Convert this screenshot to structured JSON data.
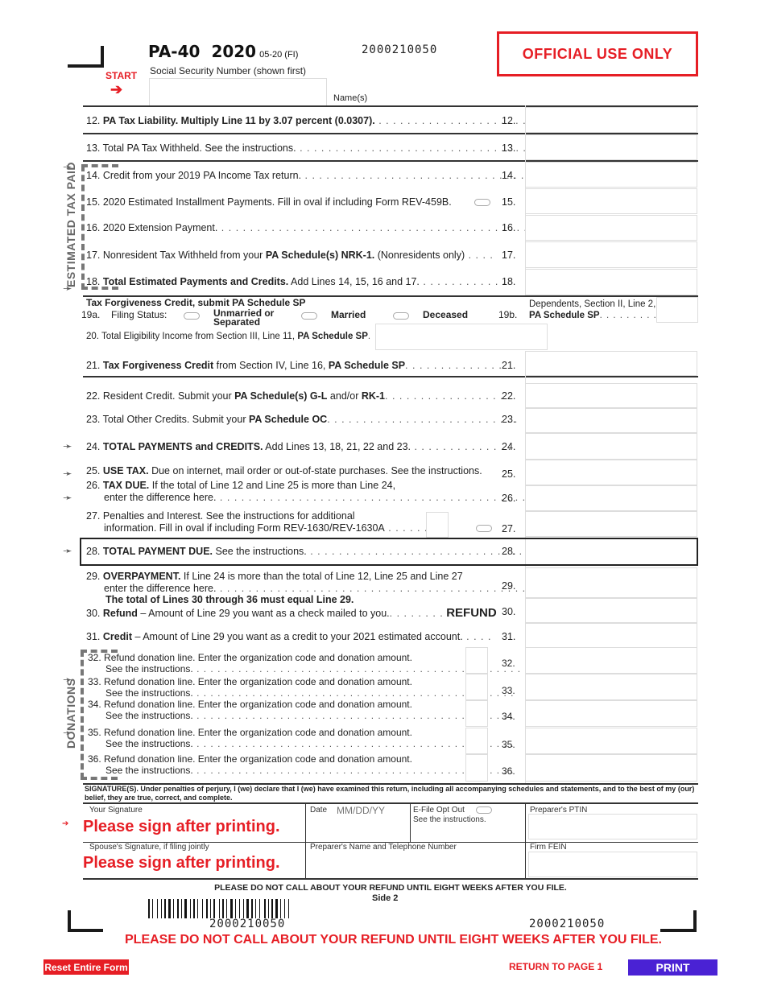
{
  "header": {
    "form_id": "PA-40",
    "year": "2020",
    "revision": "05-20 (FI)",
    "scan_code": "2000210050",
    "official_use": "OFFICIAL USE ONLY",
    "start_label": "START",
    "start_arrow": "➔",
    "ssn_label": "Social Security Number (shown first)",
    "ssn_value": "",
    "names_label": "Name(s)",
    "names_value": ""
  },
  "lines": {
    "l12": {
      "num": "12.",
      "bold": "PA Tax Liability. Multiply Line 11 by 3.07 percent (0.0307).",
      "rest": "",
      "dots": " . . . . . . . . . . . . . . . . . . . . .",
      "ln": "12.",
      "value": ""
    },
    "l13": {
      "num": "13.",
      "pre": "Total PA Tax Withheld. See the instructions.",
      "dots": " . . . . . . . . . . . . . . . . . . . . . . . . . . . . . . . . . .",
      "ln": "13.",
      "value": ""
    },
    "l14": {
      "num": "14.",
      "pre": "Credit from your 2019 PA Income Tax return.",
      "dots": " . . . . . . . . . . . . . . . . . . . . . . . . . . . . . . . .",
      "ln": "14.",
      "value": ""
    },
    "l15": {
      "num": "15.",
      "pre": "2020 Estimated Installment Payments.  Fill in oval if including Form REV-459B.",
      "ln": "15.",
      "value": "",
      "oval_checked": false
    },
    "l16": {
      "num": "16.",
      "pre": "2020 Extension Payment.",
      "dots": " . . . . . . . . . . . . . . . . . . . . . . . . . . . . . . . . . . . . . . . . . . . . .",
      "ln": "16.",
      "value": ""
    },
    "l17": {
      "num": "17.",
      "pre": "Nonresident Tax Withheld from your ",
      "bold": "PA Schedule(s) NRK-1.",
      "post": " (Nonresidents only)",
      "dots": " . . . .",
      "ln": "17.",
      "value": ""
    },
    "l18": {
      "num": "18.",
      "bold": "Total Estimated Payments and Credits.",
      "post": " Add Lines 14, 15, 16 and 17.",
      "dots": " . . . . . . . . . . . .",
      "ln": "18.",
      "value": ""
    },
    "l19": {
      "heading": "Tax Forgiveness Credit, submit PA Schedule SP",
      "num_a": "19a.",
      "filing_label": "Filing Status:",
      "options": [
        {
          "label": "Unmarried or Separated",
          "label_l1": "Unmarried or",
          "label_l2": "Separated",
          "checked": false
        },
        {
          "label": "Married",
          "checked": false
        },
        {
          "label": "Deceased",
          "checked": false
        }
      ],
      "num_b": "19b.",
      "dependents_l1": "Dependents, Section II, Line 2,",
      "dependents_bold": "PA Schedule SP",
      "dependents_dots": ". . . . . . . . . . .",
      "dependents_value": ""
    },
    "l20": {
      "num": "20.",
      "pre": "Total Eligibility Income from Section III, Line 11, ",
      "bold": "PA Schedule SP",
      "dots": ". . .",
      "value": ""
    },
    "l21": {
      "num": "21.",
      "bold": "Tax Forgiveness Credit",
      "post": " from Section IV, Line 16, ",
      "bold2": "PA Schedule SP",
      "dots": ". . . . . . . . . . . . . .",
      "ln": "21.",
      "value": ""
    },
    "l22": {
      "num": "22.",
      "pre": "Resident Credit. Submit your ",
      "bold": "PA Schedule(s) G-L",
      "post": " and/or ",
      "bold2": "RK-1",
      "dots": ". . . . . . . . . . . . . . . . .",
      "ln": "22.",
      "value": ""
    },
    "l23": {
      "num": "23.",
      "pre": "Total Other Credits. Submit your ",
      "bold": "PA Schedule OC",
      "dots": ". . . . . . . . . . . . . . . . . . . . . . . . . . .",
      "ln": "23.",
      "value": ""
    },
    "l24": {
      "num": "24.",
      "bold": "TOTAL PAYMENTS and CREDITS.",
      "post": " Add Lines 13, 18, 21, 22 and 23.",
      "dots": " . . . . . . . . . . . . . .",
      "ln": "24.",
      "value": ""
    },
    "l25": {
      "num": "25.",
      "bold": "USE TAX.",
      "post": " Due on internet, mail order or out-of-state purchases. See the instructions.",
      "ln": "25.",
      "value": ""
    },
    "l26": {
      "num": "26.",
      "bold": "TAX DUE.",
      "post": " If the total of Line 12 and Line 25 is more than Line 24,",
      "l2": "enter the difference here.",
      "dots": " . . . . . . . . . . . . . . . . . . . . . . . . . . . . . . . . . . . . . . . . . . . . . . . . .",
      "ln": "26.",
      "value": ""
    },
    "l27": {
      "num": "27.",
      "pre": "Penalties and Interest. See the instructions for additional",
      "l2": "information. Fill in oval if including Form REV-1630/REV-1630A",
      "dots": " . . . . . .",
      "ln": "27.",
      "value": "",
      "code": "",
      "oval_checked": false
    },
    "l28": {
      "num": "28.",
      "bold": "TOTAL PAYMENT DUE.",
      "post": " See the instructions.",
      "dots": " . . . . . . . . . . . . . . . . . . . . . . . . . . . . . . . . .",
      "ln": "28.",
      "value": ""
    },
    "l29": {
      "num": "29.",
      "bold": "OVERPAYMENT.",
      "post": " If Line 24 is more than the total of Line 12, Line 25 and Line 27",
      "l2": "enter the difference here.",
      "dots": " . . . . . . . . . . . . . . . . . . . . . . . . . . . . . . . . . . . . . . . . . . . . . . . .",
      "ln": "29.",
      "value": ""
    },
    "l29_note": "The total of Lines 30 through 36 must equal Line 29.",
    "l30": {
      "num": "30.",
      "bold": "Refund",
      "post": " – Amount of Line 29 you want as a check mailed to you.",
      "dots": ". . . . . . . .",
      "tag": "REFUND",
      "ln": "30.",
      "value": ""
    },
    "l31": {
      "num": "31.",
      "bold": "Credit",
      "post": " – Amount of Line 29 you want as a credit to your 2021 estimated account.",
      "dots": " . . . .",
      "ln": "31.",
      "value": ""
    },
    "donations": [
      {
        "num": "32.",
        "l1": "Refund donation line. Enter the organization code and donation amount.",
        "l2": "See the instructions.",
        "dots": " . . . . . . . . . . . . . . . . . . . . . . . . . . . . . . . . . . . . . . . . . . . . . . . .",
        "ln": "32.",
        "code": "",
        "value": ""
      },
      {
        "num": "33.",
        "l1": "Refund donation line. Enter the organization code and donation amount.",
        "l2": "See the instructions.",
        "dots": "  . . . . . . . . . . . . . . . . . . . . . . . . . . . . . . . . . . . . . . . . . . . . . .",
        "ln": "33.",
        "code": "",
        "value": ""
      },
      {
        "num": "34.",
        "l1": "Refund donation line. Enter the organization code and donation amount.",
        "l2": "See the instructions.",
        "dots": "  . . . . . . . . . . . . . . . . . . . . . . . . . . . . . . . . . . . . . . . . . . . . . .",
        "ln": "34.",
        "code": "",
        "value": ""
      },
      {
        "num": "35.",
        "l1": "Refund donation line. Enter the organization code and donation amount.",
        "l2": "See the instructions.",
        "dots": "  . . . . . . . . . . . . . . . . . . . . . . . . . . . . . . . . . . . . . . . . . . . . . .",
        "ln": "35.",
        "code": "",
        "value": ""
      },
      {
        "num": "36.",
        "l1": "Refund donation line. Enter the organization code and donation amount.",
        "l2": "See the instructions.",
        "dots": "  . . . . . . . . . . . . . . . . . . . . . . . . . . . . . . . . . . . . . . . . . . . . . .",
        "ln": "36.",
        "code": "",
        "value": ""
      }
    ]
  },
  "side_labels": {
    "estimated": "ESTIMATED TAX PAID",
    "donations": "DONATIONS",
    "arrow": "➛"
  },
  "signature": {
    "declaration": "SIGNATURE(S). Under penalties of perjury, I (we) declare that I (we) have examined this return, including all accompanying schedules and statements, and to the best of my (our) belief, they are true, correct, and complete.",
    "your_signature_label": "Your Signature",
    "sign_note": "Please sign after printing.",
    "date_label": "Date",
    "date_placeholder": "MM/DD/YY",
    "efile_label": "E-File Opt Out",
    "efile_note": "See the instructions.",
    "efile_checked": false,
    "ptin_label": "Preparer's PTIN",
    "ptin_value": "",
    "spouse_label": "Spouse's Signature, if filing jointly",
    "spouse_sign_note": "Please sign after printing.",
    "preparer_label": "Preparer's Name and Telephone Number",
    "fein_label": "Firm FEIN",
    "fein_value": ""
  },
  "footer": {
    "notice": "PLEASE DO NOT CALL ABOUT YOUR REFUND UNTIL EIGHT WEEKS AFTER YOU FILE.",
    "side": "Side 2",
    "barcode_text": "2000210050",
    "scan_code_right": "2000210050",
    "notice_red": "PLEASE DO NOT CALL ABOUT YOUR REFUND UNTIL EIGHT WEEKS AFTER YOU FILE.",
    "reset_button": "Reset Entire Form",
    "return_link": "RETURN TO PAGE 1",
    "print_button": "PRINT"
  },
  "colors": {
    "red": "#e61e25",
    "print_blue": "#4a22d4"
  }
}
